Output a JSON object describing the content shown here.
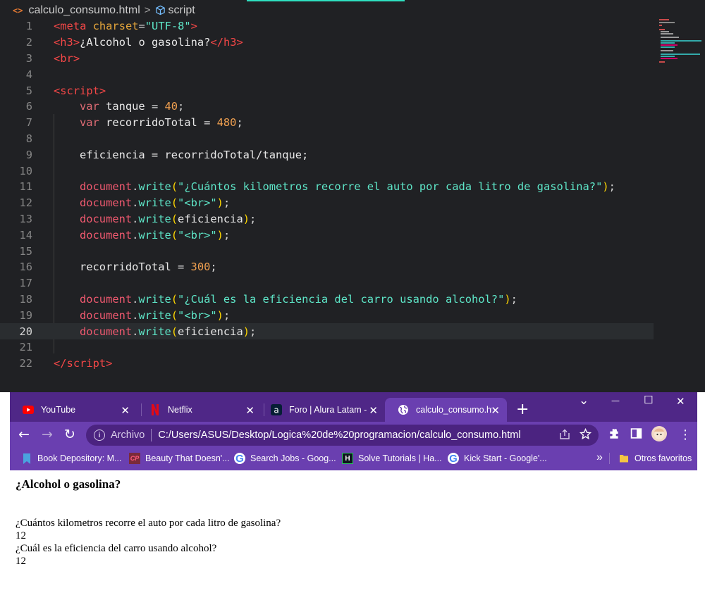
{
  "editor": {
    "breadcrumb": {
      "file_icon": "<>",
      "file": "calculo_consumo.html",
      "separator": ">",
      "symbol": "script"
    },
    "line_numbers": [
      "1",
      "2",
      "3",
      "4",
      "5",
      "6",
      "7",
      "8",
      "9",
      "10",
      "11",
      "12",
      "13",
      "14",
      "15",
      "16",
      "17",
      "18",
      "19",
      "20",
      "21",
      "22"
    ],
    "code": {
      "l1": {
        "open": "<",
        "tag": "meta",
        "attr": " charset",
        "eq": "=",
        "val": "\"UTF-8\"",
        "close": ">"
      },
      "l2": {
        "open": "<",
        "tag": "h3",
        "close": ">",
        "text": "¿Alcohol o gasolina?",
        "end_open": "</",
        "end_tag": "h3",
        "end_close": ">"
      },
      "l3": {
        "open": "<",
        "tag": "br",
        "close": ">"
      },
      "l5": {
        "open": "<",
        "tag": "script",
        "close": ">"
      },
      "l6": {
        "kw": "var",
        "name": " tanque",
        "op": " = ",
        "num": "40",
        "semi": ";"
      },
      "l7": {
        "kw": "var",
        "name": " recorridoTotal",
        "op": " = ",
        "num": "480",
        "semi": ";"
      },
      "l9": {
        "text": "eficiencia = recorridoTotal/tanque;"
      },
      "l11": {
        "obj": "document",
        "dot": ".",
        "fn": "write",
        "po": "(",
        "arg": "\"¿Cuántos kilometros recorre el auto por cada litro de gasolina?\"",
        "pc": ")",
        "semi": ";"
      },
      "l12": {
        "obj": "document",
        "dot": ".",
        "fn": "write",
        "po": "(",
        "arg": "\"<br>\"",
        "pc": ")",
        "semi": ";"
      },
      "l13": {
        "obj": "document",
        "dot": ".",
        "fn": "write",
        "po": "(",
        "arg": "eficiencia",
        "pc": ")",
        "semi": ";"
      },
      "l14": {
        "obj": "document",
        "dot": ".",
        "fn": "write",
        "po": "(",
        "arg": "\"<br>\"",
        "pc": ")",
        "semi": ";"
      },
      "l16": {
        "name": "recorridoTotal",
        "op": " = ",
        "num": "300",
        "semi": ";"
      },
      "l18": {
        "obj": "document",
        "dot": ".",
        "fn": "write",
        "po": "(",
        "arg": "\"¿Cuál es la eficiencia del carro usando alcohol?\"",
        "pc": ")",
        "semi": ";"
      },
      "l19": {
        "obj": "document",
        "dot": ".",
        "fn": "write",
        "po": "(",
        "arg": "\"<br>\"",
        "pc": ")",
        "semi": ";"
      },
      "l20": {
        "obj": "document",
        "dot": ".",
        "fn": "write",
        "po": "(",
        "arg": "eficiencia",
        "pc": ")",
        "semi": ";"
      },
      "l22": {
        "open": "</",
        "tag": "script",
        "close": ">"
      }
    }
  },
  "browser": {
    "tabs": [
      {
        "title": "YouTube",
        "icon": "youtube-icon"
      },
      {
        "title": "Netflix",
        "icon": "netflix-icon"
      },
      {
        "title": "Foro | Alura Latam - ¿",
        "icon": "alura-icon"
      },
      {
        "title": "calculo_consumo.html",
        "icon": "globe-icon"
      }
    ],
    "tab_close": "✕",
    "new_tab": "+",
    "window_controls": {
      "dropdown": "⌄",
      "minimize": "—",
      "maximize": "☐",
      "close": "✕"
    },
    "toolbar": {
      "back": "←",
      "forward": "→",
      "reload": "↻",
      "info": "i",
      "security_label": "Archivo",
      "url": "C:/Users/ASUS/Desktop/Logica%20de%20programacion/calculo_consumo.html",
      "menu": "⋮"
    },
    "bookmarks": [
      {
        "label": "Book Depository: M...",
        "icon": "bookmark-icon"
      },
      {
        "label": "Beauty That Doesn'...",
        "icon": "cp-icon",
        "icon_text": "CP"
      },
      {
        "label": "Search Jobs - Goog...",
        "icon": "google-icon",
        "icon_text": "G"
      },
      {
        "label": "Solve Tutorials | Ha...",
        "icon": "hackerrank-icon",
        "icon_text": "H"
      },
      {
        "label": "Kick Start - Google'...",
        "icon": "google-icon",
        "icon_text": "G"
      }
    ],
    "bookmarks_more": "»",
    "other_bookmarks": "Otros favoritos",
    "page": {
      "heading": "¿Alcohol o gasolina?",
      "lines": [
        "¿Cuántos kilometros recorre el auto por cada litro de gasolina?",
        "12",
        "¿Cuál es la eficiencia del carro usando alcohol?",
        "12"
      ]
    }
  }
}
